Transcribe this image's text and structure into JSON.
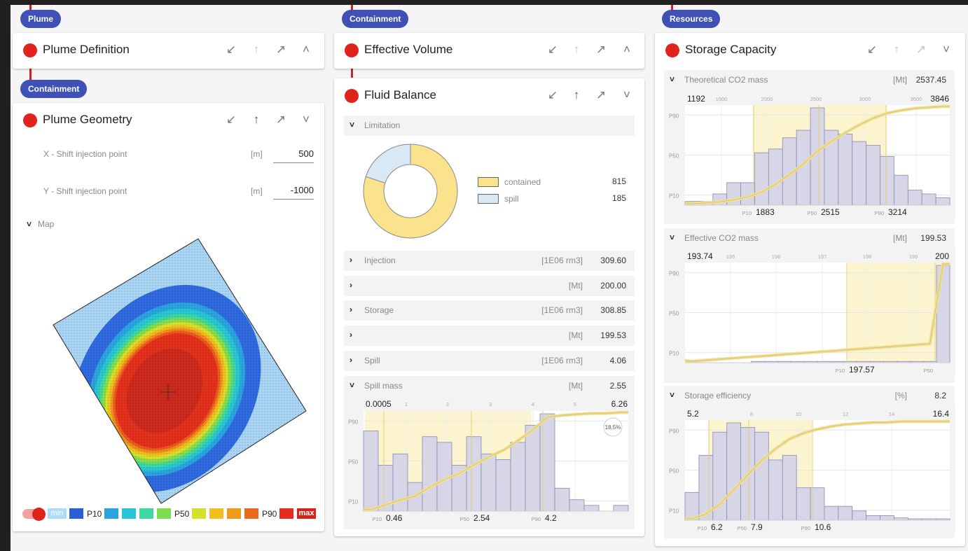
{
  "colors": {
    "accent_blue": "#3f51b5",
    "node_red": "#e0231d",
    "band_yellow": "#fbf4cf",
    "curve_yellow": "#f0df96",
    "bar_fill": "#d7d6e6",
    "bar_stroke": "#8a88b3"
  },
  "columns": [
    {
      "badges": [
        "Plume",
        "Containment"
      ],
      "cards": [
        {
          "title": "Plume Definition",
          "icons": [
            "arrow-down-left-icon",
            "arrow-up-icon",
            "arrow-up-right-icon",
            "chevron-up-icon"
          ]
        },
        {
          "title": "Plume Geometry",
          "icons": [
            "arrow-down-left-icon",
            "arrow-up-icon",
            "arrow-up-right-icon",
            "chevron-down-icon"
          ]
        }
      ]
    },
    {
      "badges": [
        "Containment"
      ],
      "cards": [
        {
          "title": "Effective Volume",
          "icons": [
            "arrow-down-left-icon",
            "arrow-up-icon",
            "arrow-up-right-icon",
            "chevron-up-icon"
          ]
        },
        {
          "title": "Fluid Balance",
          "icons": [
            "arrow-down-left-icon",
            "arrow-up-icon",
            "arrow-up-right-icon",
            "chevron-down-icon"
          ]
        }
      ]
    },
    {
      "badges": [
        "Resources"
      ],
      "cards": [
        {
          "title": "Storage Capacity",
          "icons": [
            "arrow-down-left-icon",
            "arrow-up-icon",
            "arrow-up-right-icon",
            "chevron-down-icon"
          ]
        }
      ]
    }
  ],
  "plume_geometry": {
    "fields": [
      {
        "label": "X - Shift injection point",
        "unit": "[m]",
        "value": "500"
      },
      {
        "label": "Y - Shift injection point",
        "unit": "[m]",
        "value": "-1000"
      }
    ],
    "map_label": "Map",
    "scale": [
      {
        "text": "min",
        "color": "#aedcf4",
        "is_box": true
      },
      {
        "color": "#2a5fd6"
      },
      {
        "text": "P10"
      },
      {
        "color": "#2ba3dd"
      },
      {
        "color": "#29c4d6"
      },
      {
        "color": "#3ed8a0"
      },
      {
        "color": "#7ddc4f"
      },
      {
        "text": "P50"
      },
      {
        "color": "#d6e02a"
      },
      {
        "color": "#f0c020"
      },
      {
        "color": "#f09a1c"
      },
      {
        "color": "#ec6a1e"
      },
      {
        "text": "P90"
      },
      {
        "color": "#e62c1c"
      },
      {
        "text": "max",
        "color": "#d3241c",
        "is_box": true
      }
    ]
  },
  "fluid_balance": {
    "limitation": {
      "label": "Limitation",
      "legend": [
        {
          "name": "contained",
          "value": "815",
          "color": "#fbe38d"
        },
        {
          "name": "spill",
          "value": "185",
          "color": "#d9e8f5"
        }
      ]
    },
    "rows": [
      {
        "label": "Injection",
        "unit": "[1E06 rm3]",
        "value": "309.60",
        "expanded": false
      },
      {
        "label": "",
        "unit": "[Mt]",
        "value": "200.00",
        "expanded": false
      },
      {
        "label": "Storage",
        "unit": "[1E06 rm3]",
        "value": "308.85",
        "expanded": false
      },
      {
        "label": "",
        "unit": "[Mt]",
        "value": "199.53",
        "expanded": false
      },
      {
        "label": "Spill",
        "unit": "[1E06 rm3]",
        "value": "4.06",
        "expanded": false
      },
      {
        "label": "Spill mass",
        "unit": "[Mt]",
        "value": "2.55",
        "expanded": true
      }
    ]
  },
  "storage_capacity": {
    "sections": [
      {
        "label": "Theoretical CO2 mass",
        "unit": "[Mt]",
        "value": "2537.45"
      },
      {
        "label": "Effective CO2 mass",
        "unit": "[Mt]",
        "value": "199.53"
      },
      {
        "label": "Storage efficiency",
        "unit": "[%]",
        "value": "8.2"
      }
    ]
  },
  "chart_data": [
    {
      "type": "bar",
      "name": "Spill mass distribution",
      "xlim": [
        "0.0005",
        "6.26"
      ],
      "x_ticks": [
        "1",
        "2",
        "3",
        "4",
        "5"
      ],
      "y_ticks": [
        "P90",
        "P50",
        "P10"
      ],
      "percentile_markers": [
        {
          "label": "P10",
          "value": "0.46"
        },
        {
          "label": "P50",
          "value": "2.54"
        },
        {
          "label": "P90",
          "value": "4.2"
        }
      ],
      "badge": "18.5%",
      "values": [
        14,
        8,
        10,
        5,
        13,
        12,
        8,
        13,
        10,
        9,
        12,
        15,
        17,
        4,
        2,
        1,
        0,
        1
      ],
      "cdf": [
        0,
        0.05,
        0.1,
        0.14,
        0.23,
        0.31,
        0.37,
        0.46,
        0.54,
        0.61,
        0.71,
        0.82,
        0.95,
        0.97,
        0.98,
        0.99,
        0.99,
        1
      ]
    },
    {
      "type": "bar",
      "name": "Theoretical CO2 mass distribution",
      "xlim": [
        "1192",
        "3846"
      ],
      "x_ticks": [
        "1500",
        "2000",
        "2500",
        "3000",
        "3500"
      ],
      "y_ticks": [
        "P90",
        "P50",
        "P10"
      ],
      "percentile_markers": [
        {
          "label": "P10",
          "value": "1883"
        },
        {
          "label": "P50",
          "value": "2515"
        },
        {
          "label": "P90",
          "value": "3214"
        }
      ],
      "values": [
        1,
        1,
        3,
        6,
        6,
        14,
        15,
        18,
        20,
        26,
        20,
        19,
        17,
        16,
        13,
        8,
        4,
        3,
        2
      ],
      "cdf": [
        0,
        0.01,
        0.02,
        0.04,
        0.07,
        0.12,
        0.2,
        0.3,
        0.41,
        0.54,
        0.64,
        0.73,
        0.81,
        0.88,
        0.93,
        0.96,
        0.98,
        0.99,
        1
      ]
    },
    {
      "type": "bar",
      "name": "Effective CO2 mass distribution",
      "xlim": [
        "193.74",
        "200"
      ],
      "x_ticks": [
        "195",
        "196",
        "197",
        "198",
        "199"
      ],
      "y_ticks": [
        "P90",
        "P50",
        "P10"
      ],
      "percentile_markers": [
        {
          "label": "P10",
          "value": "197.57"
        },
        {
          "label": "P50",
          "value": ""
        }
      ],
      "values": [
        0,
        0,
        0,
        0,
        0,
        1,
        1,
        1,
        1,
        1,
        1,
        1,
        1,
        1,
        1,
        1,
        1,
        1,
        1,
        80
      ],
      "cdf": [
        0,
        0.01,
        0.02,
        0.03,
        0.04,
        0.05,
        0.06,
        0.07,
        0.08,
        0.09,
        0.1,
        0.11,
        0.12,
        0.13,
        0.14,
        0.15,
        0.16,
        0.17,
        0.18,
        1
      ]
    },
    {
      "type": "bar",
      "name": "Storage efficiency distribution",
      "xlim": [
        "5.2",
        "16.4"
      ],
      "x_ticks": [
        "8",
        "10",
        "12",
        "14"
      ],
      "y_ticks": [
        "P90",
        "P50",
        "P10"
      ],
      "percentile_markers": [
        {
          "label": "P10",
          "value": "6.2"
        },
        {
          "label": "P50",
          "value": "7.9"
        },
        {
          "label": "P90",
          "value": "10.6"
        }
      ],
      "values": [
        6,
        14,
        19,
        21,
        20,
        19,
        13,
        14,
        7,
        7,
        3,
        3,
        2,
        1,
        1,
        0.5,
        0.3,
        0.3,
        0.3
      ],
      "cdf": [
        0,
        0.05,
        0.15,
        0.3,
        0.45,
        0.6,
        0.72,
        0.82,
        0.88,
        0.92,
        0.95,
        0.97,
        0.98,
        0.99,
        0.99,
        1,
        1,
        1,
        1
      ]
    }
  ]
}
